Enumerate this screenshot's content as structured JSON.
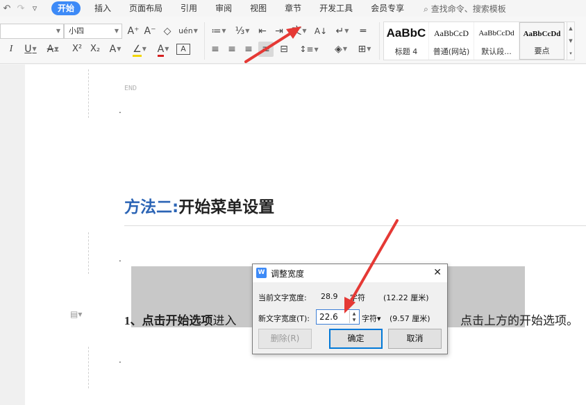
{
  "quick_access": [
    {
      "name": "undo-icon",
      "glyph": "↶"
    },
    {
      "name": "redo-icon",
      "glyph": "↷"
    },
    {
      "name": "quick-access-dropdown-icon",
      "glyph": "▿"
    }
  ],
  "menu_tabs": [
    {
      "label": "开始",
      "active": true
    },
    {
      "label": "插入",
      "active": false
    },
    {
      "label": "页面布局",
      "active": false
    },
    {
      "label": "引用",
      "active": false
    },
    {
      "label": "审阅",
      "active": false
    },
    {
      "label": "视图",
      "active": false
    },
    {
      "label": "章节",
      "active": false
    },
    {
      "label": "开发工具",
      "active": false
    },
    {
      "label": "会员专享",
      "active": false
    }
  ],
  "search": {
    "icon": "search-icon",
    "glyph": "⌕",
    "placeholder": "查找命令、搜索模板"
  },
  "ribbon": {
    "font_name": "",
    "font_size": "小四",
    "grow_font": "A⁺",
    "shrink_font": "A⁻",
    "clear_format": "◇",
    "phonetic": "uén",
    "italic": "I",
    "underline": "U",
    "strikethrough": "A",
    "superscript": "X²",
    "subscript": "X₂",
    "text_effect": "A",
    "highlight": "∠",
    "font_color": "A",
    "char_border": "A",
    "bullets": "≔",
    "numbering": "⅓",
    "decrease_indent": "⇤",
    "increase_indent": "⇥",
    "chinese_layout": "文",
    "sort": "A↓",
    "show_marks": "↵",
    "ruler": "═",
    "align_left": "≡",
    "align_center": "≡",
    "align_right": "≡",
    "justify": "≡",
    "distributed": "⊟",
    "line_spacing": "↕≡",
    "shading": "◈",
    "borders": "⊞",
    "highlight_color": "#f2d600",
    "font_color_value": "#d62020"
  },
  "styles": [
    {
      "sample": "AaBbC",
      "name": "标题 4"
    },
    {
      "sample": "AaBbCcD",
      "name": "普通(网站)"
    },
    {
      "sample": "AaBbCcDd",
      "name": "默认段..."
    },
    {
      "sample": "AaBbCcDd",
      "name": "要点"
    }
  ],
  "styles_scroll": [
    "▲",
    "▼",
    "▾"
  ],
  "document": {
    "end_mark": "END",
    "para_mark": ".",
    "heading_highlight": "方法二:",
    "heading_rest": "开始菜单设置",
    "line1_bold": "1、点击开始选项",
    "line1_normal": "进入",
    "line1_tail": "点击上方的开始选项。",
    "margin_icon": "▤▾"
  },
  "dialog": {
    "app_icon": "W",
    "title": "调整宽度",
    "close": "✕",
    "current_label": "当前文字宽度:",
    "current_value": "28.9",
    "current_unit": "字符",
    "current_cm": "(12.22 厘米)",
    "new_label": "新文字宽度(T):",
    "new_value": "22.6",
    "spin": "▲▼",
    "unit_dropdown": "字符▾",
    "new_cm": "(9.57 厘米)",
    "delete_button": "删除(R)",
    "ok_button": "确定",
    "cancel_button": "取消"
  },
  "colors": {
    "accent": "#3d8af7",
    "heading_blue": "#2b64b5",
    "arrow_red": "#e53935",
    "selection_gray": "#c8c8c8"
  }
}
